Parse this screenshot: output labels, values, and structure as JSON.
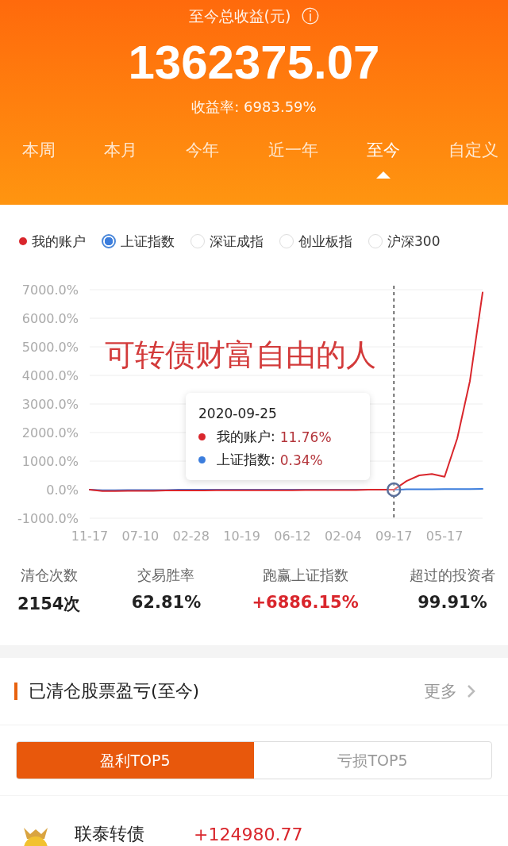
{
  "header": {
    "title": "至今总收益(元)",
    "info_icon": "ⓘ",
    "total": "1362375.07",
    "rate": "收益率: 6983.59%"
  },
  "period_tabs": [
    {
      "label": "本周",
      "selected": false
    },
    {
      "label": "本月",
      "selected": false
    },
    {
      "label": "今年",
      "selected": false
    },
    {
      "label": "近一年",
      "selected": false
    },
    {
      "label": "至今",
      "selected": true
    },
    {
      "label": "自定义",
      "selected": false
    }
  ],
  "legend": [
    {
      "kind": "dot",
      "color": "#d9262c"
    },
    {
      "kind": "radio",
      "selected": true
    },
    {
      "kind": "radio",
      "label": "深证成指",
      "selected": false
    },
    {
      "kind": "radio",
      "label": "创业板指",
      "selected": false
    },
    {
      "kind": "radio",
      "label": "沪深300",
      "selected": false
    }
  ],
  "chart": {
    "overlay_caption": "可转债财富自由的人",
    "tooltip": {
      "date": "2020-09-25",
      "rows": [
        {
          "label": "我的账户:",
          "value": "11.76%",
          "color": "#d9262c"
        },
        {
          "label": "上证指数:",
          "value": "0.34%",
          "color": "#3b7ddd"
        }
      ]
    },
    "chart_data": {
      "type": "line",
      "categories": [
        "11-17",
        null,
        null,
        null,
        "07-10",
        null,
        null,
        null,
        "02-28",
        null,
        null,
        null,
        "10-19",
        null,
        null,
        null,
        "06-12",
        null,
        null,
        null,
        "02-04",
        null,
        null,
        null,
        "09-17",
        null,
        null,
        null,
        "05-17",
        null,
        null,
        null
      ],
      "series": [
        {
          "name": "我的账户",
          "color": "#d9262c",
          "values": [
            0,
            -50,
            -50,
            -40,
            -40,
            -40,
            -30,
            -30,
            -30,
            -30,
            -20,
            -20,
            -20,
            -20,
            -20,
            -20,
            -20,
            -10,
            -10,
            -10,
            -10,
            -10,
            0,
            0,
            0,
            300,
            500,
            550,
            450,
            1800,
            3800,
            6900
          ]
        },
        {
          "name": "上证指数",
          "color": "#3b7ddd",
          "values": [
            0,
            -20,
            -20,
            -10,
            -10,
            -10,
            -10,
            0,
            0,
            0,
            0,
            0,
            0,
            0,
            0,
            0,
            0,
            0,
            0,
            0,
            0,
            0,
            0,
            0,
            0,
            10,
            10,
            10,
            20,
            20,
            20,
            30
          ]
        }
      ],
      "ylim": [
        -1000,
        7000
      ],
      "yticks": [
        {
          "value": 7000,
          "label": "7000.0%"
        },
        {
          "value": 6000,
          "label": "6000.0%"
        },
        {
          "value": 5000,
          "label": "5000.0%"
        },
        {
          "value": 4000,
          "label": "4000.0%"
        },
        {
          "value": 3000,
          "label": "3000.0%"
        },
        {
          "value": 2000,
          "label": "2000.0%"
        },
        {
          "value": 1000,
          "label": "1000.0%"
        },
        {
          "value": 0,
          "label": "0.0%"
        },
        {
          "value": -1000,
          "label": "-1000.0%"
        }
      ],
      "grid": true,
      "annotations": [
        {
          "x": "09-17"
        }
      ]
    }
  },
  "stats": [
    {
      "label": "清仓次数",
      "value": "2154次",
      "color": "#222222"
    },
    {
      "label": "交易胜率",
      "value": "62.81%",
      "color": "#222222"
    },
    {
      "label": "跑赢上证指数",
      "value": "+6886.15%",
      "color": "#d9262c"
    },
    {
      "label": "超过的投资者",
      "value": "99.91%",
      "color": "#222222"
    }
  ],
  "section": {
    "title": "已清仓股票盈亏(至今)",
    "more": "更多"
  },
  "segments": [
    {
      "label": "盈利TOP5",
      "selected": true
    },
    {
      "label": "亏损TOP5",
      "selected": false
    }
  ],
  "rows": [
    {
      "name": "联泰转债",
      "profit": "+124980.77"
    }
  ]
}
